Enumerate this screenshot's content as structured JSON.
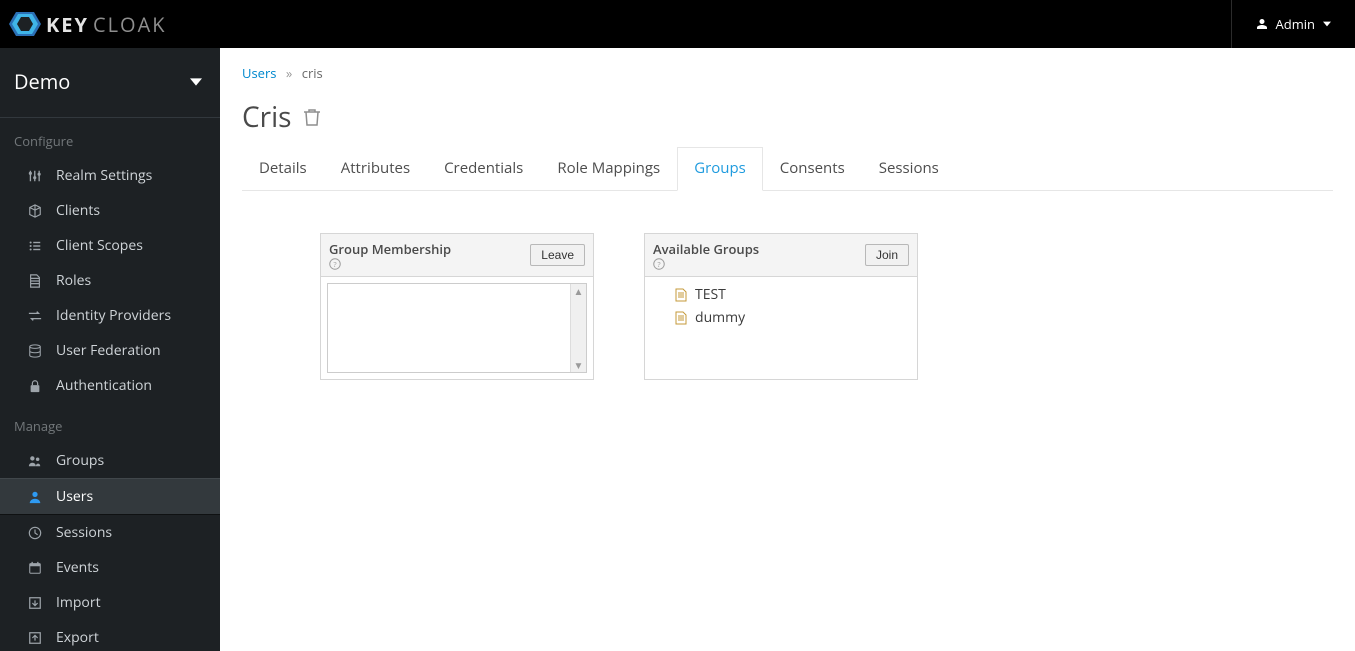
{
  "header": {
    "brand_bold": "KEY",
    "brand_light": "CLOAK",
    "user_label": "Admin"
  },
  "realm": {
    "name": "Demo"
  },
  "sidebar": {
    "section_configure": "Configure",
    "section_manage": "Manage",
    "configure": [
      {
        "label": "Realm Settings"
      },
      {
        "label": "Clients"
      },
      {
        "label": "Client Scopes"
      },
      {
        "label": "Roles"
      },
      {
        "label": "Identity Providers"
      },
      {
        "label": "User Federation"
      },
      {
        "label": "Authentication"
      }
    ],
    "manage": [
      {
        "label": "Groups"
      },
      {
        "label": "Users"
      },
      {
        "label": "Sessions"
      },
      {
        "label": "Events"
      },
      {
        "label": "Import"
      },
      {
        "label": "Export"
      }
    ]
  },
  "breadcrumb": {
    "parent": "Users",
    "current": "cris"
  },
  "page": {
    "title": "Cris"
  },
  "tabs": [
    {
      "label": "Details"
    },
    {
      "label": "Attributes"
    },
    {
      "label": "Credentials"
    },
    {
      "label": "Role Mappings"
    },
    {
      "label": "Groups"
    },
    {
      "label": "Consents"
    },
    {
      "label": "Sessions"
    }
  ],
  "membership_panel": {
    "title": "Group Membership",
    "button": "Leave"
  },
  "available_panel": {
    "title": "Available Groups",
    "button": "Join",
    "items": [
      {
        "label": "TEST"
      },
      {
        "label": "dummy"
      }
    ]
  }
}
